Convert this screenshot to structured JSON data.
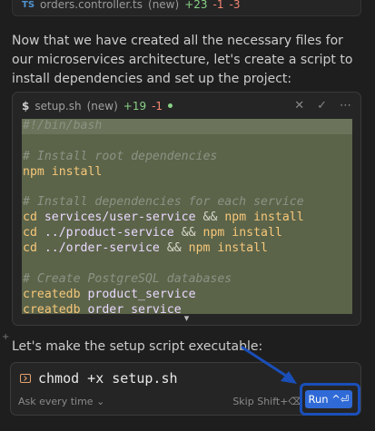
{
  "top_file": {
    "name": "orders.controller.ts",
    "status": "(new)",
    "additions": "+23",
    "deletions": "-1",
    "extra": "-3"
  },
  "message": "Now that we have created all the necessary files for our microservices architecture, let's create a script to install dependencies and set up the project:",
  "code_card": {
    "prompt_symbol": "$",
    "filename": "setup.sh",
    "status": "(new)",
    "additions": "+19",
    "deletions": "-1",
    "lines": [
      [
        {
          "t": "#!/bin/bash",
          "c": "comment"
        }
      ],
      [],
      [
        {
          "t": "# Install root dependencies",
          "c": "comment"
        }
      ],
      [
        {
          "t": "npm install",
          "c": "kw"
        }
      ],
      [],
      [
        {
          "t": "# Install dependencies for each service",
          "c": "comment"
        }
      ],
      [
        {
          "t": "cd ",
          "c": "kw"
        },
        {
          "t": "services/user-service ",
          "c": "plain"
        },
        {
          "t": "&& ",
          "c": "op"
        },
        {
          "t": "npm install",
          "c": "kw"
        }
      ],
      [
        {
          "t": "cd ",
          "c": "kw"
        },
        {
          "t": "../product-service ",
          "c": "plain"
        },
        {
          "t": "&& ",
          "c": "op"
        },
        {
          "t": "npm install",
          "c": "kw"
        }
      ],
      [
        {
          "t": "cd ",
          "c": "kw"
        },
        {
          "t": "../order-service ",
          "c": "plain"
        },
        {
          "t": "&& ",
          "c": "op"
        },
        {
          "t": "npm install",
          "c": "kw"
        }
      ],
      [],
      [
        {
          "t": "# Create PostgreSQL databases",
          "c": "comment"
        }
      ],
      [
        {
          "t": "createdb ",
          "c": "kw"
        },
        {
          "t": "product_service",
          "c": "plain"
        }
      ],
      [
        {
          "t": "createdb ",
          "c": "kw"
        },
        {
          "t": "order service",
          "c": "plain"
        }
      ]
    ]
  },
  "exec_message": "Let's make the setup script executable:",
  "command": {
    "text": "chmod +x setup.sh",
    "ask_label": "Ask every time",
    "skip_label": "Skip Shift+⌫",
    "run_label": "Run ^⏎"
  },
  "colors": {
    "accent": "#2f6ad6",
    "highlight_frame": "#1a4fb9",
    "code_bg": "#5b6449"
  }
}
